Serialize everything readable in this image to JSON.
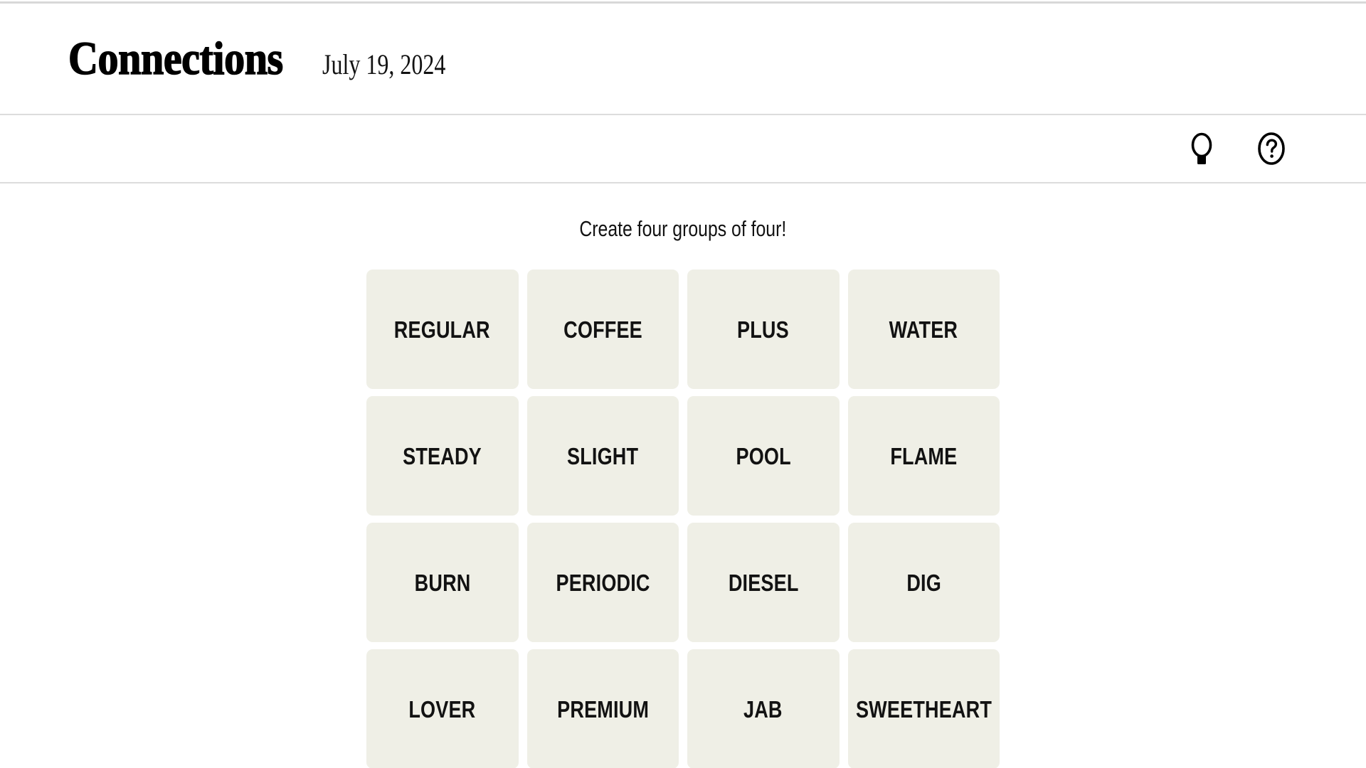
{
  "header": {
    "title": "Connections",
    "date": "July 19, 2024"
  },
  "toolbar": {
    "hint_icon": "lightbulb-icon",
    "hint_label": "Hint",
    "help_icon": "question-mark-circle-icon",
    "help_label": "Help"
  },
  "board": {
    "instruction": "Create four groups of four!",
    "tile_color": "#EFEFE6",
    "text_color": "#121212",
    "rows": 4,
    "columns": 4,
    "tiles": [
      {
        "label": "REGULAR"
      },
      {
        "label": "COFFEE"
      },
      {
        "label": "PLUS"
      },
      {
        "label": "WATER"
      },
      {
        "label": "STEADY"
      },
      {
        "label": "SLIGHT"
      },
      {
        "label": "POOL"
      },
      {
        "label": "FLAME"
      },
      {
        "label": "BURN"
      },
      {
        "label": "PERIODIC"
      },
      {
        "label": "DIESEL"
      },
      {
        "label": "DIG"
      },
      {
        "label": "LOVER"
      },
      {
        "label": "PREMIUM"
      },
      {
        "label": "JAB"
      },
      {
        "label": "SWEETHEART"
      }
    ]
  }
}
